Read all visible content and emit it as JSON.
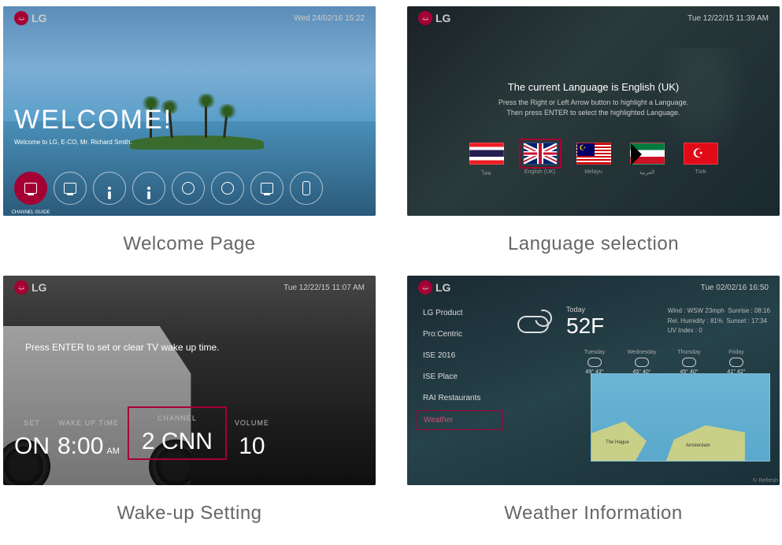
{
  "captions": {
    "welcome": "Welcome Page",
    "language": "Language selection",
    "wakeup": "Wake-up Setting",
    "weather": "Weather Information"
  },
  "brand": "LG",
  "welcome": {
    "clock": "Wed 24/02/16 15:22",
    "title": "WELCOME!",
    "subtitle": "Welcome to LG, E-CO, Mr. Richard Smith.",
    "icons": [
      {
        "id": "channel-guide",
        "label": "CHANNEL GUIDE"
      },
      {
        "id": "hotel-info",
        "label": ""
      },
      {
        "id": "info-1",
        "label": ""
      },
      {
        "id": "info-2",
        "label": ""
      },
      {
        "id": "world",
        "label": ""
      },
      {
        "id": "alarm",
        "label": ""
      },
      {
        "id": "media",
        "label": ""
      },
      {
        "id": "remote",
        "label": ""
      }
    ]
  },
  "language": {
    "clock": "Tue 12/22/15 11:39 AM",
    "title": "The current Language is English (UK)",
    "hint1": "Press the Right or Left Arrow button to highlight a Language.",
    "hint2": "Then press ENTER to select the highlighted Language.",
    "flags": [
      {
        "code": "th",
        "label": "ไทย"
      },
      {
        "code": "uk",
        "label": "English (UK)",
        "selected": true
      },
      {
        "code": "my",
        "label": "Melayu"
      },
      {
        "code": "kw",
        "label": "العربية"
      },
      {
        "code": "tr",
        "label": "Türk"
      }
    ]
  },
  "wakeup": {
    "clock": "Tue 12/22/15 11:07 AM",
    "hint": "Press ENTER to set or clear TV wake up time.",
    "cols": {
      "set": {
        "hd": "SET",
        "val": "ON"
      },
      "time": {
        "hd": "WAKE UP TIME",
        "val": "8:00",
        "suffix": "AM"
      },
      "channel": {
        "hd": "CHANNEL",
        "val": "2 CNN",
        "selected": true
      },
      "volume": {
        "hd": "VOLUME",
        "val": "10"
      }
    }
  },
  "weather": {
    "clock": "Tue 02/02/16 16:50",
    "menu": [
      {
        "label": "LG Product"
      },
      {
        "label": "Pro:Centric"
      },
      {
        "label": "ISE 2016"
      },
      {
        "label": "ISE Place"
      },
      {
        "label": "RAI Restaurants"
      },
      {
        "label": "Weather",
        "selected": true
      }
    ],
    "today_label": "Today",
    "temp": "52F",
    "stats": {
      "wind": "Wind : WSW 23mph",
      "sunrise": "Sunrise : 08:16",
      "humidity": "Rel. Humidity : 81%",
      "sunset": "Sunset : 17:34",
      "uv": "UV Index : 0"
    },
    "forecast": [
      {
        "day": "Tuesday",
        "hi": "49°",
        "lo": "43°"
      },
      {
        "day": "Wednesday",
        "hi": "45°",
        "lo": "40°"
      },
      {
        "day": "Thursday",
        "hi": "45°",
        "lo": "40°"
      },
      {
        "day": "Friday",
        "hi": "41°",
        "lo": "42°"
      }
    ],
    "map_labels": {
      "a": "The Hague",
      "b": "Amsterdam"
    },
    "refresh": "↻ Refresh"
  }
}
